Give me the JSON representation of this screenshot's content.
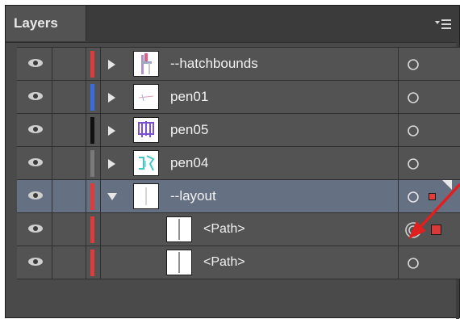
{
  "panel": {
    "tab_label": "Layers",
    "menu_icon": "panel-menu-icon"
  },
  "layers": [
    {
      "name": "--hatchbounds",
      "color": "#e03b3b",
      "expanded": false,
      "selected": false,
      "thumb_icon": "hatch-thumbnail"
    },
    {
      "name": "pen01",
      "color": "#3b6be0",
      "expanded": false,
      "selected": false,
      "thumb_icon": "pen01-thumbnail"
    },
    {
      "name": "pen05",
      "color": "#111111",
      "expanded": false,
      "selected": false,
      "thumb_icon": "pen05-thumbnail"
    },
    {
      "name": "pen04",
      "color": "#7a7a7a",
      "expanded": false,
      "selected": false,
      "thumb_icon": "pen04-thumbnail"
    },
    {
      "name": "--layout",
      "color": "#e03b3b",
      "expanded": true,
      "selected": true,
      "thumb_icon": "layout-thumbnail"
    },
    {
      "name": "<Path>",
      "color": "#e03b3b",
      "sublayer": true,
      "targeted": true,
      "thumb_icon": "path-thumbnail"
    },
    {
      "name": "<Path>",
      "color": "#e03b3b",
      "sublayer": true,
      "targeted": false,
      "thumb_icon": "path-thumbnail"
    }
  ],
  "colors": {
    "panel_bg": "#535353",
    "selected_row": "#667083",
    "annotation_arrow": "#e01f1f"
  }
}
